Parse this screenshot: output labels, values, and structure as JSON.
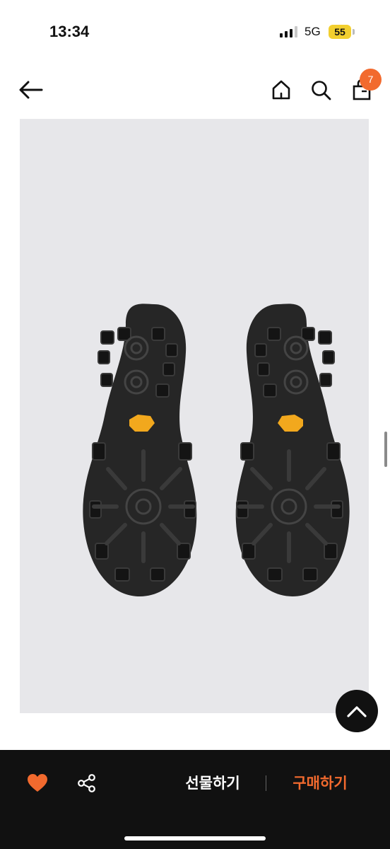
{
  "status_bar": {
    "time": "13:34",
    "network": "5G",
    "battery": "55"
  },
  "header": {
    "back_icon": "arrow-left-icon",
    "home_icon": "home-icon",
    "search_icon": "search-icon",
    "cart_icon": "shopping-bag-icon",
    "cart_count": "7"
  },
  "product": {
    "image": "shoe-soles-photo"
  },
  "bottom_bar": {
    "like_icon": "heart-icon",
    "share_icon": "share-icon",
    "gift_label": "선물하기",
    "buy_label": "구매하기"
  },
  "colors": {
    "accent": "#f26a2e",
    "bar_bg": "#111111",
    "image_bg": "#e7e7ea",
    "battery": "#f2cf2f"
  }
}
